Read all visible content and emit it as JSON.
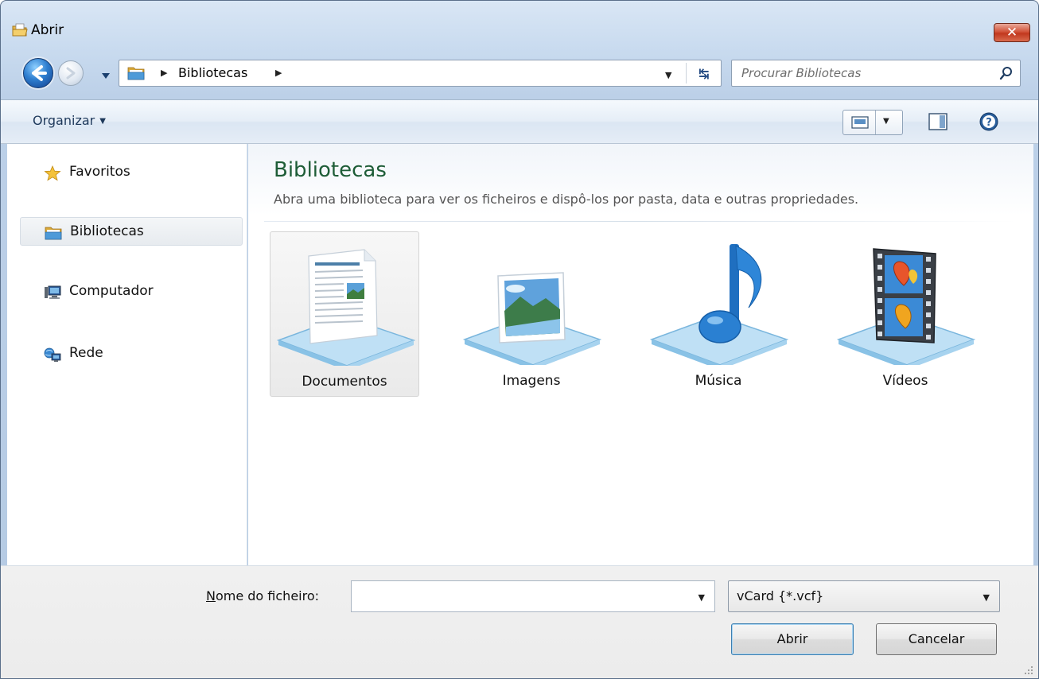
{
  "window": {
    "title": "Abrir",
    "close_label": "✕"
  },
  "navigation": {
    "breadcrumb": "Bibliotecas",
    "search_placeholder": "Procurar Bibliotecas"
  },
  "toolbar": {
    "organize_label": "Organizar"
  },
  "sidebar": {
    "items": [
      {
        "label": "Favoritos",
        "icon": "star-icon"
      },
      {
        "label": "Bibliotecas",
        "icon": "libraries-folder-icon",
        "selected": true
      },
      {
        "label": "Computador",
        "icon": "computer-icon"
      },
      {
        "label": "Rede",
        "icon": "network-icon"
      }
    ]
  },
  "content": {
    "title": "Bibliotecas",
    "description": "Abra uma biblioteca para ver os ficheiros e dispô-los por pasta, data e outras propriedades.",
    "libraries": [
      {
        "label": "Documentos",
        "icon": "documents-library-icon",
        "selected": true
      },
      {
        "label": "Imagens",
        "icon": "pictures-library-icon"
      },
      {
        "label": "Música",
        "icon": "music-library-icon"
      },
      {
        "label": "Vídeos",
        "icon": "videos-library-icon"
      }
    ]
  },
  "footer": {
    "filename_label_accel": "N",
    "filename_label_rest": "ome do ficheiro:",
    "filename_value": "",
    "filetype_value": "vCard {*.vcf}",
    "open_label": "Abrir",
    "cancel_label": "Cancelar"
  },
  "colors": {
    "title_green": "#1e5d37",
    "accent_blue": "#3c7fb1",
    "close_red": "#c1381e"
  }
}
